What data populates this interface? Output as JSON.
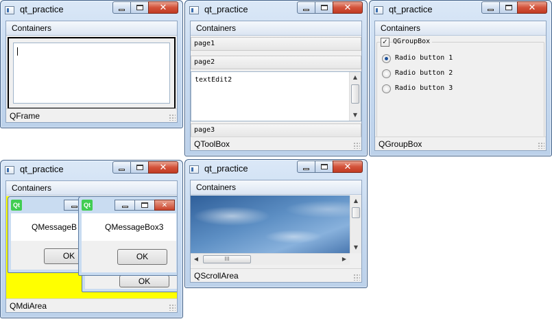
{
  "windows": {
    "frame": {
      "title": "qt_practice",
      "menu": "Containers",
      "status": "QFrame"
    },
    "toolbox": {
      "title": "qt_practice",
      "menu": "Containers",
      "status": "QToolBox",
      "pages": [
        "page1",
        "page2",
        "page3"
      ],
      "text_edit": "textEdit2"
    },
    "groupbox": {
      "title": "qt_practice",
      "menu": "Containers",
      "status": "QGroupBox",
      "group_title": "QGroupBox",
      "radios": [
        "Radio button 1",
        "Radio button 2",
        "Radio button 3"
      ],
      "selected_radio": "Radio button 1"
    },
    "mdi": {
      "title": "qt_practice",
      "menu": "Containers",
      "status": "QMdiArea",
      "subwindows": [
        {
          "message": "QMessageBox3",
          "ok": "OK"
        },
        {
          "message": "QMessageB",
          "ok": "OK"
        },
        {
          "ok": "OK"
        }
      ]
    },
    "scroll": {
      "title": "qt_practice",
      "menu": "Containers",
      "status": "QScrollArea",
      "hscroll_thumb": "III"
    }
  },
  "glyphs": {
    "close": "✕",
    "up": "▲",
    "down": "▼",
    "left": "◀",
    "right": "▶",
    "check": "✓"
  },
  "colors": {
    "mdi_background": "#ffff00",
    "close_button": "#c9432b"
  }
}
